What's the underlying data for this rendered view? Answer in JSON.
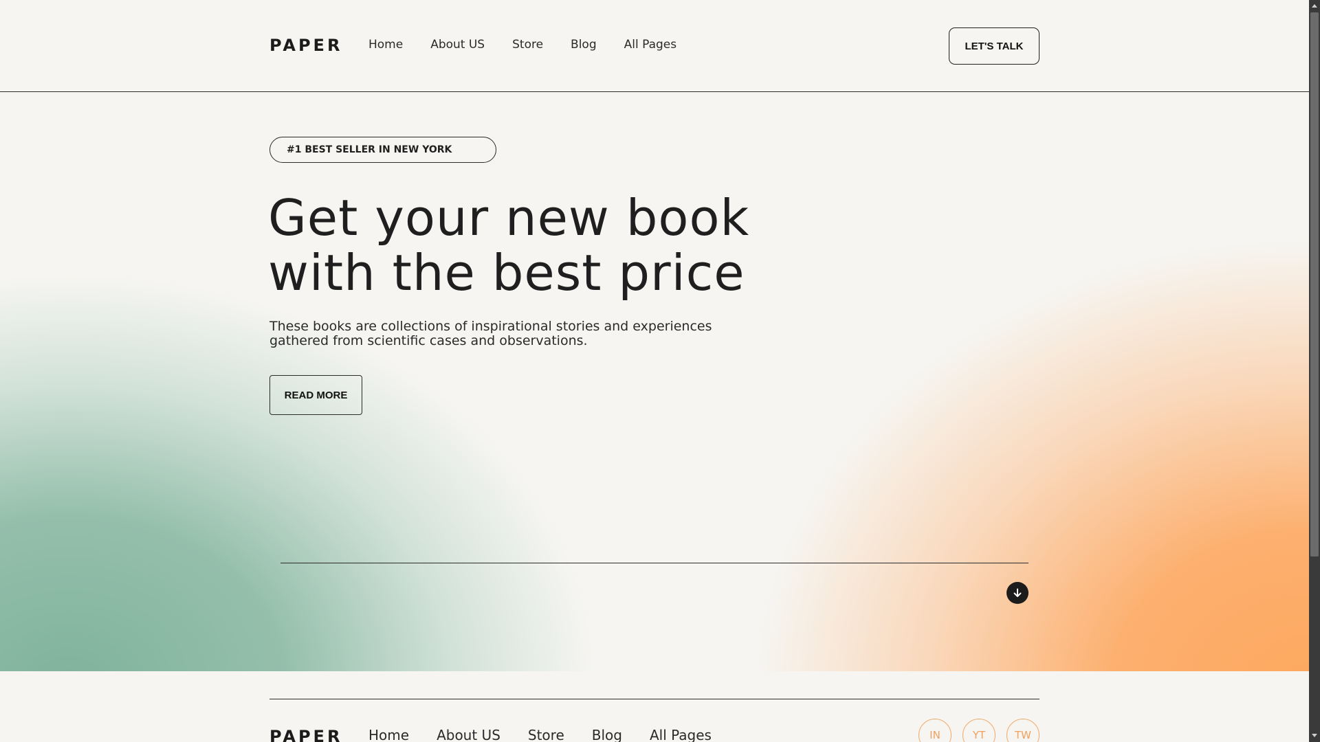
{
  "header": {
    "logo": "PAPER",
    "nav": [
      "Home",
      "About US",
      "Store",
      "Blog",
      "All Pages"
    ],
    "cta_label": "LET'S TALK"
  },
  "hero": {
    "badge": "#1 BEST SELLER IN NEW YORK",
    "headline_line1": "Get your new book",
    "headline_line2": "with the best price",
    "subtext_line1": "These books are collections of inspirational stories and experiences",
    "subtext_line2": "gathered from scientific cases and observations.",
    "read_more_label": "READ MORE",
    "scroll_icon": "arrow-down-icon",
    "colors": {
      "green": "#80b39c",
      "orange": "#fda85f",
      "background": "#f6f5f1"
    }
  },
  "footer": {
    "logo": "PAPER",
    "nav": [
      "Home",
      "About US",
      "Store",
      "Blog",
      "All Pages"
    ],
    "socials": [
      "IN",
      "YT",
      "TW"
    ],
    "social_color": "#f3a86a"
  }
}
